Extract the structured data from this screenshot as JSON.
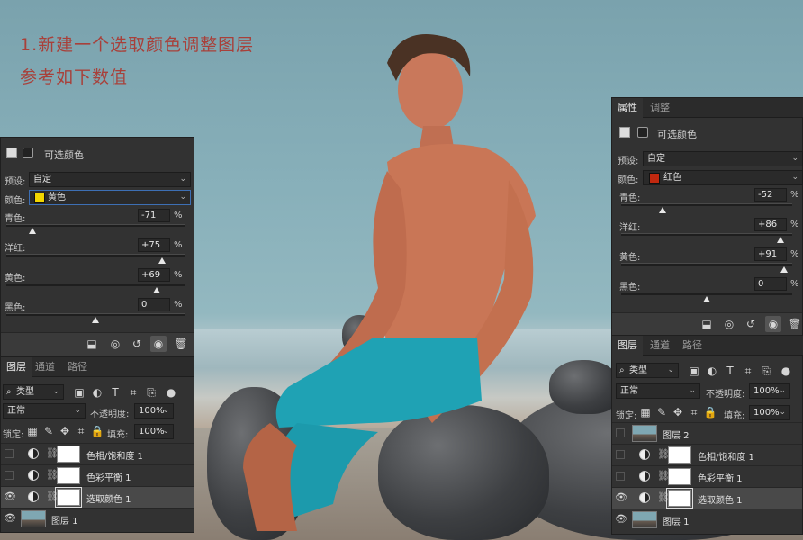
{
  "instructions": {
    "line1": "1.新建一个选取颜色调整图层",
    "line2": "参考如下数值"
  },
  "left_properties": {
    "title": "可选颜色",
    "preset_label": "预设:",
    "preset_value": "自定",
    "colors_label": "颜色:",
    "colors_value": "黄色",
    "colors_swatch": "#f2d600",
    "sliders": [
      {
        "label": "青色:",
        "value": "-71",
        "unit": "%",
        "level": -71
      },
      {
        "label": "洋红:",
        "value": "+75",
        "unit": "%",
        "level": 75
      },
      {
        "label": "黄色:",
        "value": "+69",
        "unit": "%",
        "level": 69
      },
      {
        "label": "黑色:",
        "value": "0",
        "unit": "%",
        "level": 0
      }
    ]
  },
  "right_properties": {
    "tabs": [
      "属性",
      "调整"
    ],
    "title": "可选颜色",
    "preset_label": "预设:",
    "preset_value": "自定",
    "colors_label": "颜色:",
    "colors_value": "红色",
    "colors_swatch": "#c0280f",
    "sliders": [
      {
        "label": "青色:",
        "value": "-52",
        "unit": "%",
        "level": -52
      },
      {
        "label": "洋红:",
        "value": "+86",
        "unit": "%",
        "level": 86
      },
      {
        "label": "黄色:",
        "value": "+91",
        "unit": "%",
        "level": 91
      },
      {
        "label": "黑色:",
        "value": "0",
        "unit": "%",
        "level": 0
      }
    ]
  },
  "left_layers": {
    "tabs": [
      "图层",
      "通道",
      "路径"
    ],
    "filter_label": "类型",
    "blend_mode": "正常",
    "opacity_label": "不透明度:",
    "opacity_value": "100%",
    "lock_label": "锁定:",
    "fill_label": "填充:",
    "fill_value": "100%",
    "layers": [
      {
        "name": "色相/饱和度 1",
        "visible": false,
        "kind": "adjustment"
      },
      {
        "name": "色彩平衡 1",
        "visible": false,
        "kind": "adjustment"
      },
      {
        "name": "选取颜色 1",
        "visible": true,
        "kind": "adjustment",
        "active": true
      },
      {
        "name": "图层 1",
        "visible": true,
        "kind": "image"
      }
    ]
  },
  "right_layers": {
    "tabs": [
      "图层",
      "通道",
      "路径"
    ],
    "filter_label": "类型",
    "blend_mode": "正常",
    "opacity_label": "不透明度:",
    "opacity_value": "100%",
    "lock_label": "锁定:",
    "fill_label": "填充:",
    "fill_value": "100%",
    "layers": [
      {
        "name": "图层 2",
        "visible": false,
        "kind": "image"
      },
      {
        "name": "色相/饱和度 1",
        "visible": false,
        "kind": "adjustment"
      },
      {
        "name": "色彩平衡 1",
        "visible": false,
        "kind": "adjustment"
      },
      {
        "name": "选取颜色 1",
        "visible": true,
        "kind": "adjustment",
        "active": true
      },
      {
        "name": "图层 1",
        "visible": true,
        "kind": "image"
      }
    ]
  }
}
